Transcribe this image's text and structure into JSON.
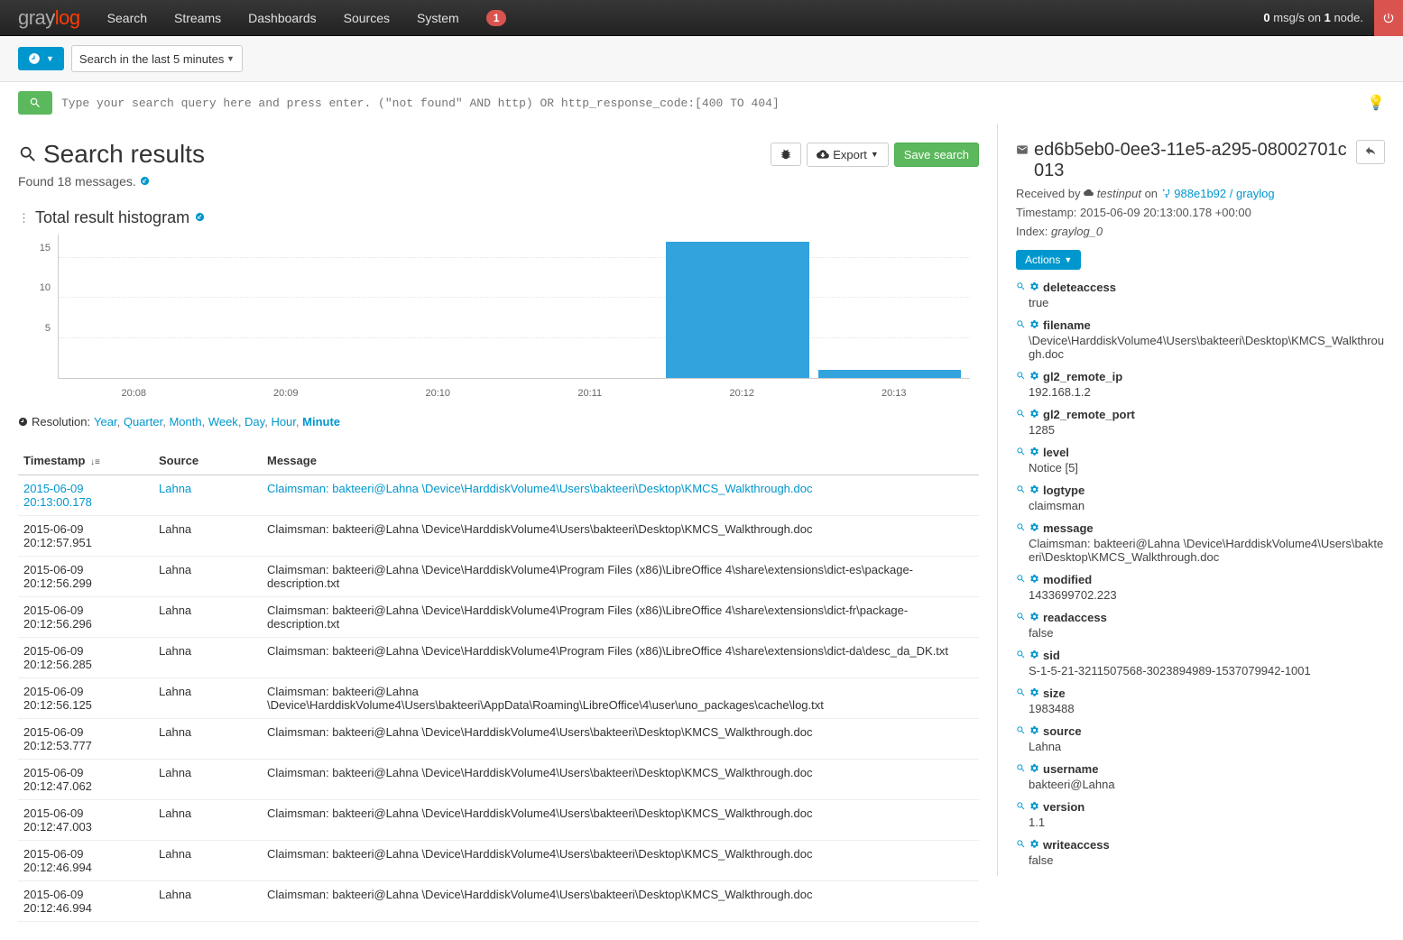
{
  "navbar": {
    "logo_gray": "gray",
    "logo_log": "log",
    "items": [
      "Search",
      "Streams",
      "Dashboards",
      "Sources",
      "System"
    ],
    "system_badge": "1",
    "status_html": {
      "prefix": "",
      "bold1": "0",
      "mid": " msg/s on ",
      "bold2": "1",
      "suffix": " node."
    }
  },
  "searchbar": {
    "range_label": "Search in the last 5 minutes",
    "query_placeholder": "Type your search query here and press enter. (\"not found\" AND http) OR http_response_code:[400 TO 404]"
  },
  "results_head": {
    "title": "Search results",
    "found": "Found 18 messages.",
    "export_label": "Export",
    "save_label": "Save search"
  },
  "histogram": {
    "title": "Total result histogram"
  },
  "chart_data": {
    "type": "bar",
    "categories": [
      "20:08",
      "20:09",
      "20:10",
      "20:11",
      "20:12",
      "20:13"
    ],
    "values": [
      0,
      0,
      0,
      0,
      17,
      1
    ],
    "title": "Total result histogram",
    "xlabel": "",
    "ylabel": "",
    "yticks": [
      5,
      10,
      15
    ],
    "ylim": [
      0,
      18
    ]
  },
  "resolution": {
    "label": "Resolution:",
    "options": [
      "Year",
      "Quarter",
      "Month",
      "Week",
      "Day",
      "Hour",
      "Minute"
    ],
    "active": "Minute"
  },
  "table": {
    "headers": {
      "ts": "Timestamp",
      "src": "Source",
      "msg": "Message"
    },
    "rows": [
      {
        "ts": "2015-06-09 20:13:00.178",
        "src": "Lahna",
        "msg": "Claimsman: bakteeri@Lahna \\Device\\HarddiskVolume4\\Users\\bakteeri\\Desktop\\KMCS_Walkthrough.doc",
        "selected": true
      },
      {
        "ts": "2015-06-09 20:12:57.951",
        "src": "Lahna",
        "msg": "Claimsman: bakteeri@Lahna \\Device\\HarddiskVolume4\\Users\\bakteeri\\Desktop\\KMCS_Walkthrough.doc"
      },
      {
        "ts": "2015-06-09 20:12:56.299",
        "src": "Lahna",
        "msg": "Claimsman: bakteeri@Lahna \\Device\\HarddiskVolume4\\Program Files (x86)\\LibreOffice 4\\share\\extensions\\dict-es\\package-description.txt"
      },
      {
        "ts": "2015-06-09 20:12:56.296",
        "src": "Lahna",
        "msg": "Claimsman: bakteeri@Lahna \\Device\\HarddiskVolume4\\Program Files (x86)\\LibreOffice 4\\share\\extensions\\dict-fr\\package-description.txt"
      },
      {
        "ts": "2015-06-09 20:12:56.285",
        "src": "Lahna",
        "msg": "Claimsman: bakteeri@Lahna \\Device\\HarddiskVolume4\\Program Files (x86)\\LibreOffice 4\\share\\extensions\\dict-da\\desc_da_DK.txt"
      },
      {
        "ts": "2015-06-09 20:12:56.125",
        "src": "Lahna",
        "msg": "Claimsman: bakteeri@Lahna \\Device\\HarddiskVolume4\\Users\\bakteeri\\AppData\\Roaming\\LibreOffice\\4\\user\\uno_packages\\cache\\log.txt"
      },
      {
        "ts": "2015-06-09 20:12:53.777",
        "src": "Lahna",
        "msg": "Claimsman: bakteeri@Lahna \\Device\\HarddiskVolume4\\Users\\bakteeri\\Desktop\\KMCS_Walkthrough.doc"
      },
      {
        "ts": "2015-06-09 20:12:47.062",
        "src": "Lahna",
        "msg": "Claimsman: bakteeri@Lahna \\Device\\HarddiskVolume4\\Users\\bakteeri\\Desktop\\KMCS_Walkthrough.doc"
      },
      {
        "ts": "2015-06-09 20:12:47.003",
        "src": "Lahna",
        "msg": "Claimsman: bakteeri@Lahna \\Device\\HarddiskVolume4\\Users\\bakteeri\\Desktop\\KMCS_Walkthrough.doc"
      },
      {
        "ts": "2015-06-09 20:12:46.994",
        "src": "Lahna",
        "msg": "Claimsman: bakteeri@Lahna \\Device\\HarddiskVolume4\\Users\\bakteeri\\Desktop\\KMCS_Walkthrough.doc"
      },
      {
        "ts": "2015-06-09 20:12:46.994",
        "src": "Lahna",
        "msg": "Claimsman: bakteeri@Lahna \\Device\\HarddiskVolume4\\Users\\bakteeri\\Desktop\\KMCS_Walkthrough.doc"
      }
    ]
  },
  "detail": {
    "id": "ed6b5eb0-0ee3-11e5-a295-08002701c013",
    "received_prefix": "Received by",
    "input_name": "testinput",
    "on_word": "on",
    "node_link": "988e1b92 / graylog",
    "timestamp_label": "Timestamp:",
    "timestamp": "2015-06-09 20:13:00.178 +00:00",
    "index_label": "Index:",
    "index": "graylog_0",
    "actions_label": "Actions",
    "fields": [
      {
        "name": "deleteaccess",
        "value": "true"
      },
      {
        "name": "filename",
        "value": "\\Device\\HarddiskVolume4\\Users\\bakteeri\\Desktop\\KMCS_Walkthrough.doc"
      },
      {
        "name": "gl2_remote_ip",
        "value": "192.168.1.2"
      },
      {
        "name": "gl2_remote_port",
        "value": "1285"
      },
      {
        "name": "level",
        "value": "Notice [5]"
      },
      {
        "name": "logtype",
        "value": "claimsman"
      },
      {
        "name": "message",
        "value": "Claimsman: bakteeri@Lahna \\Device\\HarddiskVolume4\\Users\\bakteeri\\Desktop\\KMCS_Walkthrough.doc"
      },
      {
        "name": "modified",
        "value": "1433699702.223"
      },
      {
        "name": "readaccess",
        "value": "false"
      },
      {
        "name": "sid",
        "value": "S-1-5-21-3211507568-3023894989-1537079942-1001"
      },
      {
        "name": "size",
        "value": "1983488"
      },
      {
        "name": "source",
        "value": "Lahna"
      },
      {
        "name": "username",
        "value": "bakteeri@Lahna"
      },
      {
        "name": "version",
        "value": "1.1"
      },
      {
        "name": "writeaccess",
        "value": "false"
      }
    ]
  }
}
